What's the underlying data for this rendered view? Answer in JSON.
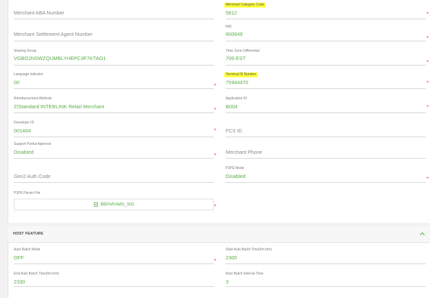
{
  "fields": {
    "merchant_aba": {
      "placeholder": "Merchant ABA Number"
    },
    "mcc": {
      "label": "Merchant Category Code",
      "value": "5812"
    },
    "settlement_agent": {
      "placeholder": "Merchant Settlement Agent Number"
    },
    "rid": {
      "label": "RID",
      "value": "600649"
    },
    "sharing_group": {
      "label": "Sharing Group",
      "value": "VGBOJNSWZQUMBLYHEPC3F7KTAO1"
    },
    "tz_diff": {
      "label": "Time Zone Differential",
      "value": "705-EST"
    },
    "language": {
      "label": "Language indicator",
      "value": "00"
    },
    "terminal_id": {
      "label": "Terminal ID Number",
      "value": "75944470"
    },
    "reimbursement": {
      "label": "Reimbursement Attribute",
      "value": "Z/Standard INTERLINK Retail Merchant"
    },
    "application_id": {
      "label": "Application ID",
      "value": "B004"
    },
    "developer_id": {
      "label": "Developer ID",
      "value": "001464"
    },
    "fcs_id": {
      "placeholder": "FCS ID"
    },
    "partial_approval": {
      "label": "Support Partial Approval",
      "value": "Disabled"
    },
    "merchant_phone": {
      "placeholder": "Merchant Phone"
    },
    "gen2_auth": {
      "placeholder": "Gen2 Auth Code"
    },
    "p2pe_mode": {
      "label": "P2PE Mode",
      "value": "Disabled"
    },
    "p2pe_param_file": {
      "label": "P2PE Param File",
      "file_name": "BBPARAMS_SIG"
    }
  },
  "host_feature": {
    "title": "HOST FEATURE",
    "auto_batch_mode": {
      "label": "Auto Batch Mode",
      "value": "OFF"
    },
    "start_batch_time": {
      "label": "Start Auto Batch Time(hh:mm)",
      "value": "2300"
    },
    "end_batch_time": {
      "label": "End Auto Batch Time(hh:mm)",
      "value": "2330"
    },
    "batch_interval": {
      "label": "Auto Batch Interval Time",
      "value": "3"
    }
  },
  "icons": {
    "file": "file-icon",
    "collapse": "chevron-up-icon",
    "required": "asterisk"
  },
  "colors": {
    "value": "#5aaa47",
    "required": "#e8453c",
    "highlight": "#ffff3a",
    "label": "#7a7a7a"
  },
  "required_mark": "*"
}
